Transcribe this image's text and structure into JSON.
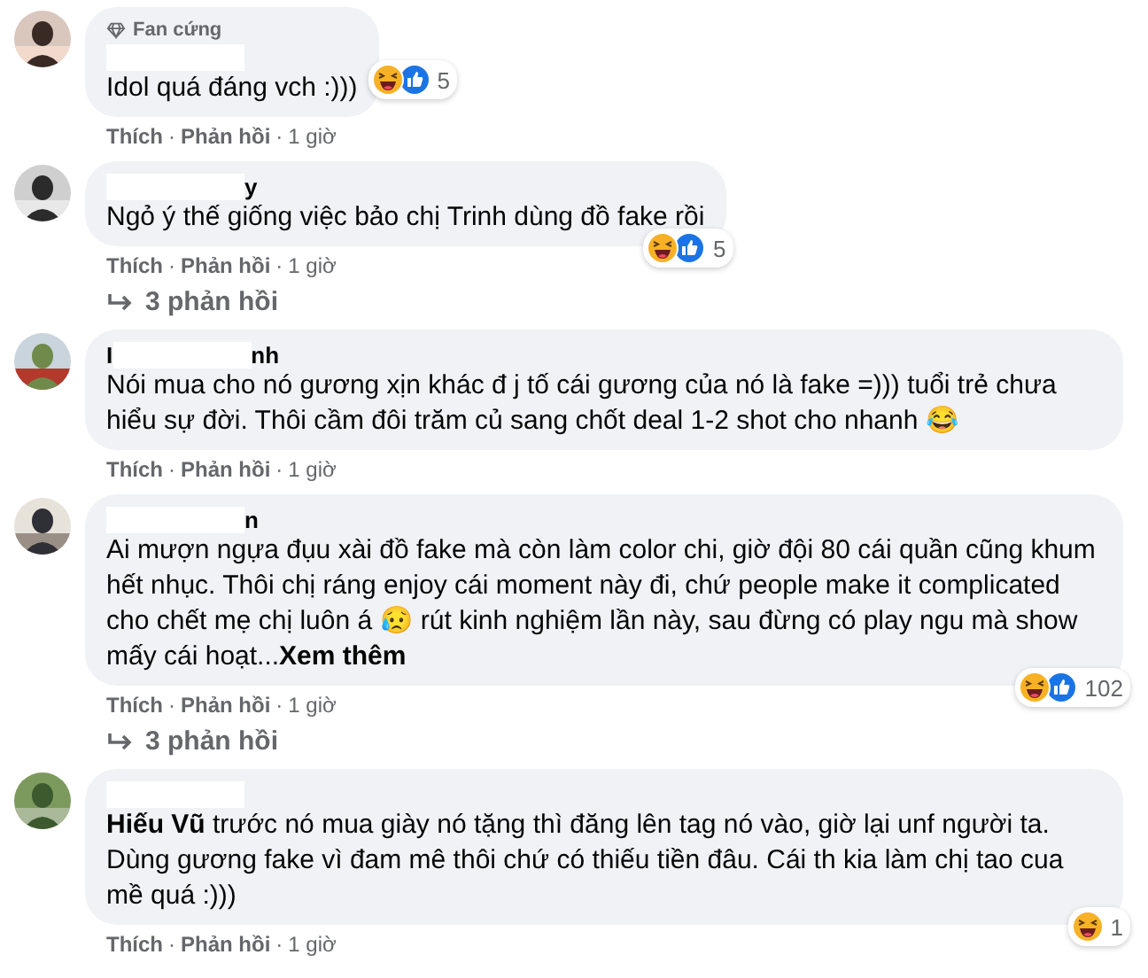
{
  "comments": [
    {
      "badge": "Fan cứng",
      "author": {
        "redacted": true
      },
      "text": "Idol quá đáng vch :)))",
      "reactions": {
        "kind": "side",
        "types": [
          {
            "kind": "haha"
          },
          {
            "kind": "like"
          }
        ],
        "count": "5"
      },
      "actions": [
        {
          "kind": "link",
          "text": "Thích"
        },
        {
          "kind": "separator",
          "text": "·"
        },
        {
          "kind": "link",
          "text": "Phản hồi"
        },
        {
          "kind": "separator",
          "text": "·"
        },
        {
          "kind": "time",
          "text": "1 giờ"
        }
      ]
    },
    {
      "author": {
        "redacted": true,
        "visible_end": "y"
      },
      "text": "Ngỏ ý thế giống việc bảo chị Trinh dùng đồ fake rồi",
      "reactions": {
        "kind": "corner",
        "types": [
          {
            "kind": "haha"
          },
          {
            "kind": "like"
          }
        ],
        "count": "5"
      },
      "actions": [
        {
          "kind": "link",
          "text": "Thích"
        },
        {
          "kind": "separator",
          "text": "·"
        },
        {
          "kind": "link",
          "text": "Phản hồi"
        },
        {
          "kind": "separator",
          "text": "·"
        },
        {
          "kind": "time",
          "text": "1 giờ"
        }
      ],
      "replies": "3 phản hồi"
    },
    {
      "author": {
        "redacted": true,
        "visible_start": "I",
        "visible_end": "nh"
      },
      "text": "Nói mua cho nó gương xịn khác đ j tố cái gương của nó là fake =))) tuổi trẻ chưa hiểu sự đời. Thôi cầm đôi trăm củ sang chốt deal 1-2 shot cho nhanh 😂",
      "actions": [
        {
          "kind": "link",
          "text": "Thích"
        },
        {
          "kind": "separator",
          "text": "·"
        },
        {
          "kind": "link",
          "text": "Phản hồi"
        },
        {
          "kind": "separator",
          "text": "·"
        },
        {
          "kind": "time",
          "text": "1 giờ"
        }
      ]
    },
    {
      "author": {
        "redacted": true,
        "visible_end": "n"
      },
      "text": "Ai mượn ngựa đụu xài đồ fake mà còn làm color chi, giờ đội 80 cái quần cũng khum hết nhục. Thôi chị ráng enjoy cái moment này đi, chứ people make it complicated cho chết mẹ chị luôn á 😥 rút kinh nghiệm lần này, sau đừng có play ngu mà show mấy cái hoạt...",
      "see_more": "Xem thêm",
      "reactions": {
        "kind": "corner",
        "types": [
          {
            "kind": "haha"
          },
          {
            "kind": "like"
          }
        ],
        "count": "102"
      },
      "actions": [
        {
          "kind": "link",
          "text": "Thích"
        },
        {
          "kind": "separator",
          "text": "·"
        },
        {
          "kind": "link",
          "text": "Phản hồi"
        },
        {
          "kind": "separator",
          "text": "·"
        },
        {
          "kind": "time",
          "text": "1 giờ"
        }
      ],
      "replies": "3 phản hồi"
    },
    {
      "author": {
        "redacted": true
      },
      "text": "**Hiếu Vũ** trước nó mua giày nó tặng thì đăng lên tag nó vào, giờ lại unf người ta. Dùng gương fake vì đam mê thôi chứ có thiếu tiền đâu. Cái th kia làm chị tao cua mề quá :)))",
      "reactions": {
        "kind": "corner",
        "types": [
          {
            "kind": "haha"
          }
        ],
        "count": "1"
      },
      "actions": [
        {
          "kind": "link",
          "text": "Thích"
        },
        {
          "kind": "separator",
          "text": "·"
        },
        {
          "kind": "link",
          "text": "Phản hồi"
        },
        {
          "kind": "separator",
          "text": "·"
        },
        {
          "kind": "time",
          "text": "1 giờ"
        }
      ]
    }
  ]
}
